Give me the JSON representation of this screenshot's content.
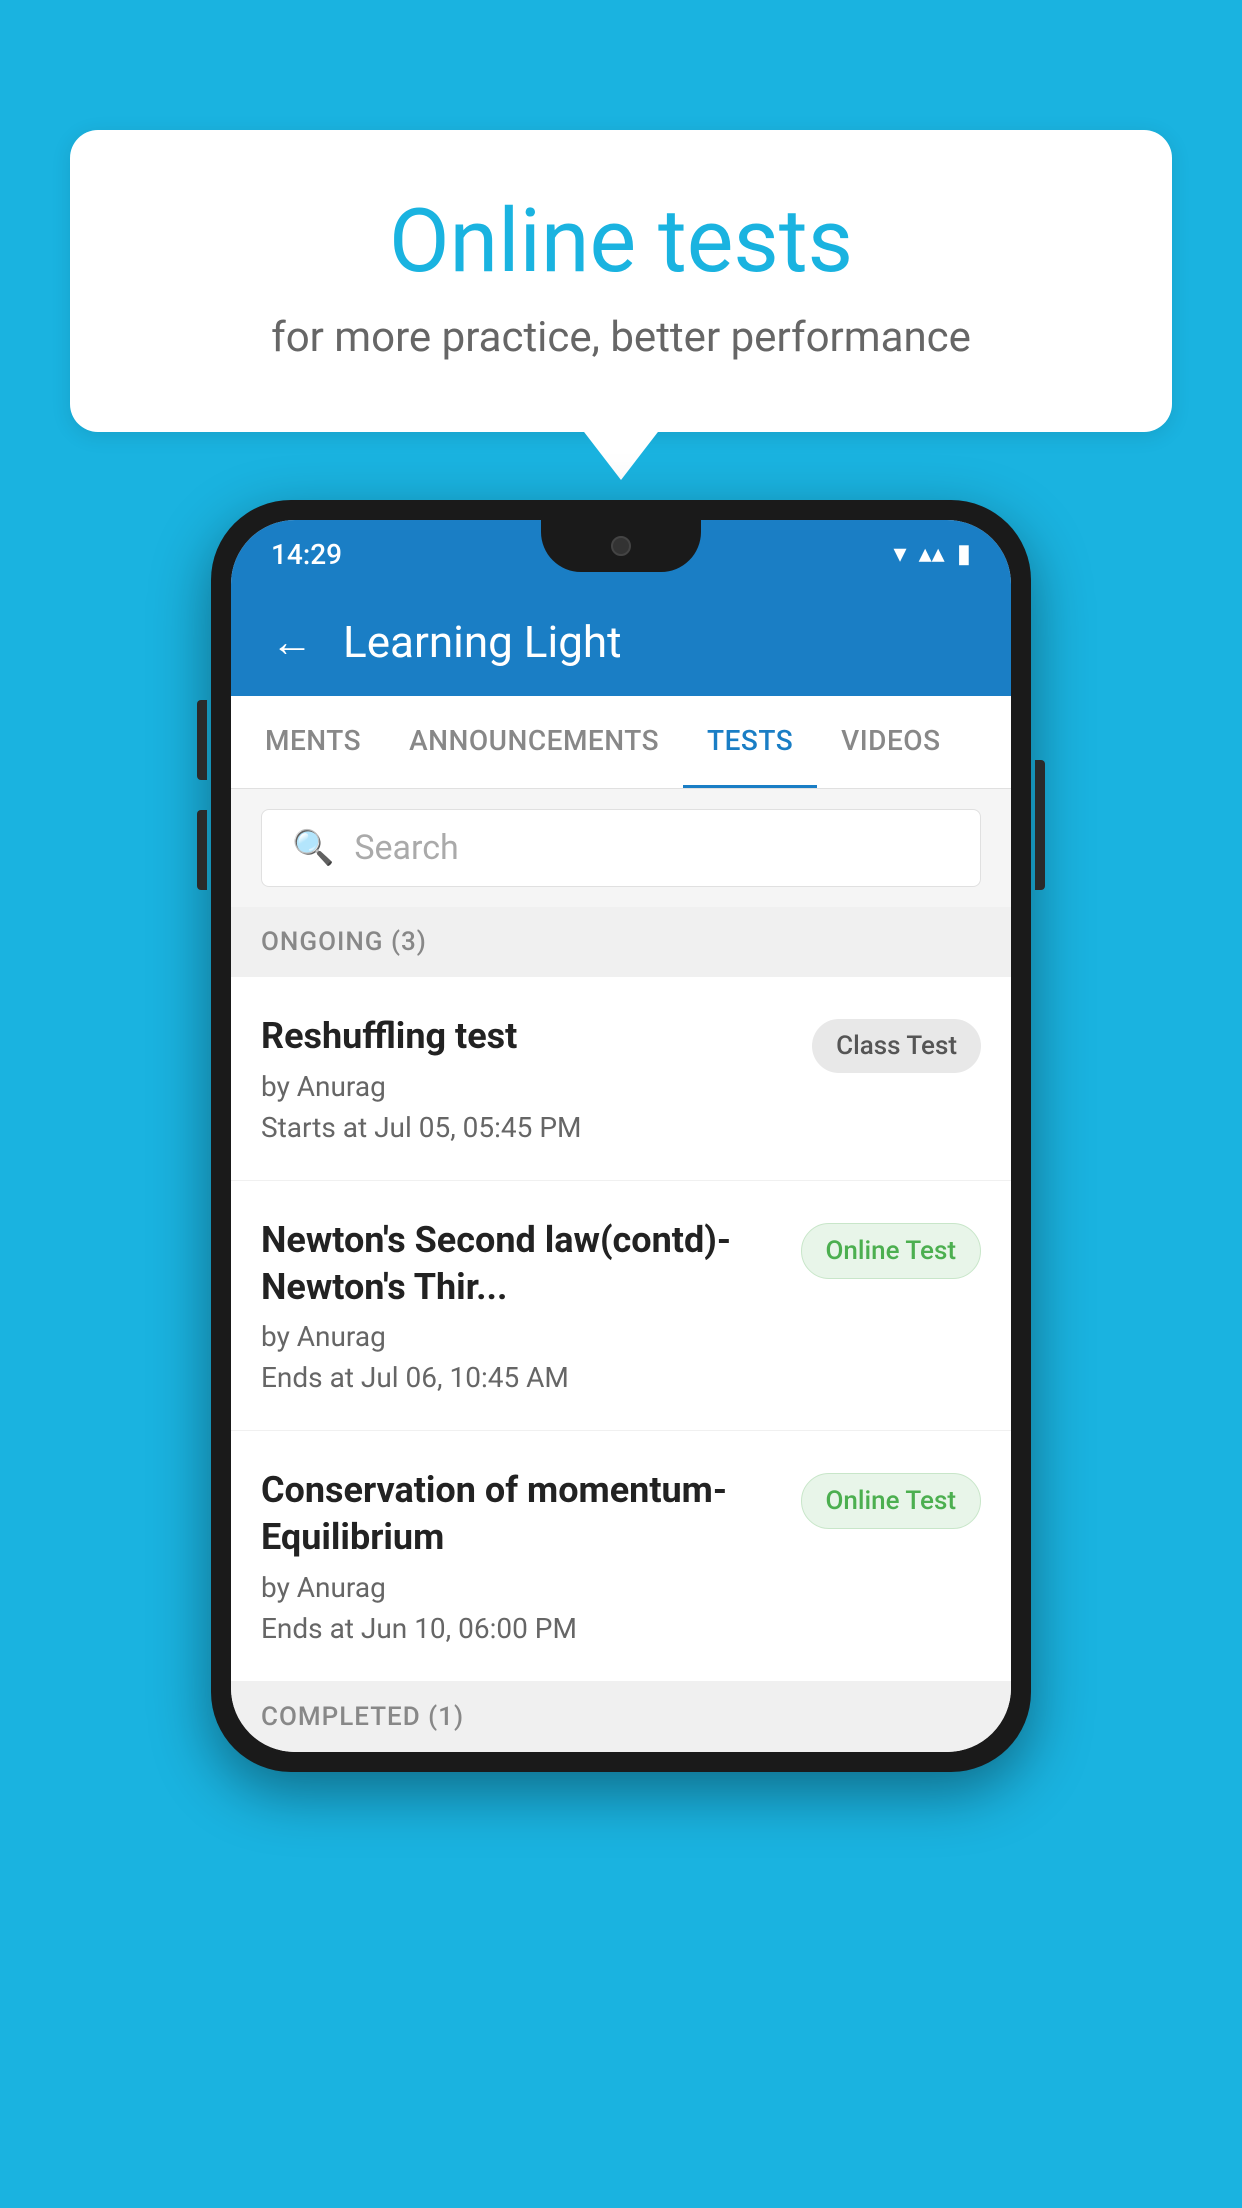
{
  "background_color": "#1ab3e0",
  "speech_bubble": {
    "title": "Online tests",
    "subtitle": "for more practice, better performance"
  },
  "phone": {
    "status_bar": {
      "time": "14:29",
      "wifi_icon": "▼",
      "signal_icon": "▲",
      "battery_icon": "▮"
    },
    "app_header": {
      "title": "Learning Light",
      "back_label": "←"
    },
    "tabs": [
      {
        "label": "MENTS",
        "active": false
      },
      {
        "label": "ANNOUNCEMENTS",
        "active": false
      },
      {
        "label": "TESTS",
        "active": true
      },
      {
        "label": "VIDEOS",
        "active": false
      }
    ],
    "search": {
      "placeholder": "Search"
    },
    "ongoing_section": {
      "label": "ONGOING (3)"
    },
    "test_items": [
      {
        "name": "Reshuffling test",
        "by": "by Anurag",
        "date": "Starts at  Jul 05, 05:45 PM",
        "badge": "Class Test",
        "badge_type": "class"
      },
      {
        "name": "Newton's Second law(contd)-Newton's Thir...",
        "by": "by Anurag",
        "date": "Ends at  Jul 06, 10:45 AM",
        "badge": "Online Test",
        "badge_type": "online"
      },
      {
        "name": "Conservation of momentum-Equilibrium",
        "by": "by Anurag",
        "date": "Ends at  Jun 10, 06:00 PM",
        "badge": "Online Test",
        "badge_type": "online"
      }
    ],
    "completed_section": {
      "label": "COMPLETED (1)"
    }
  }
}
